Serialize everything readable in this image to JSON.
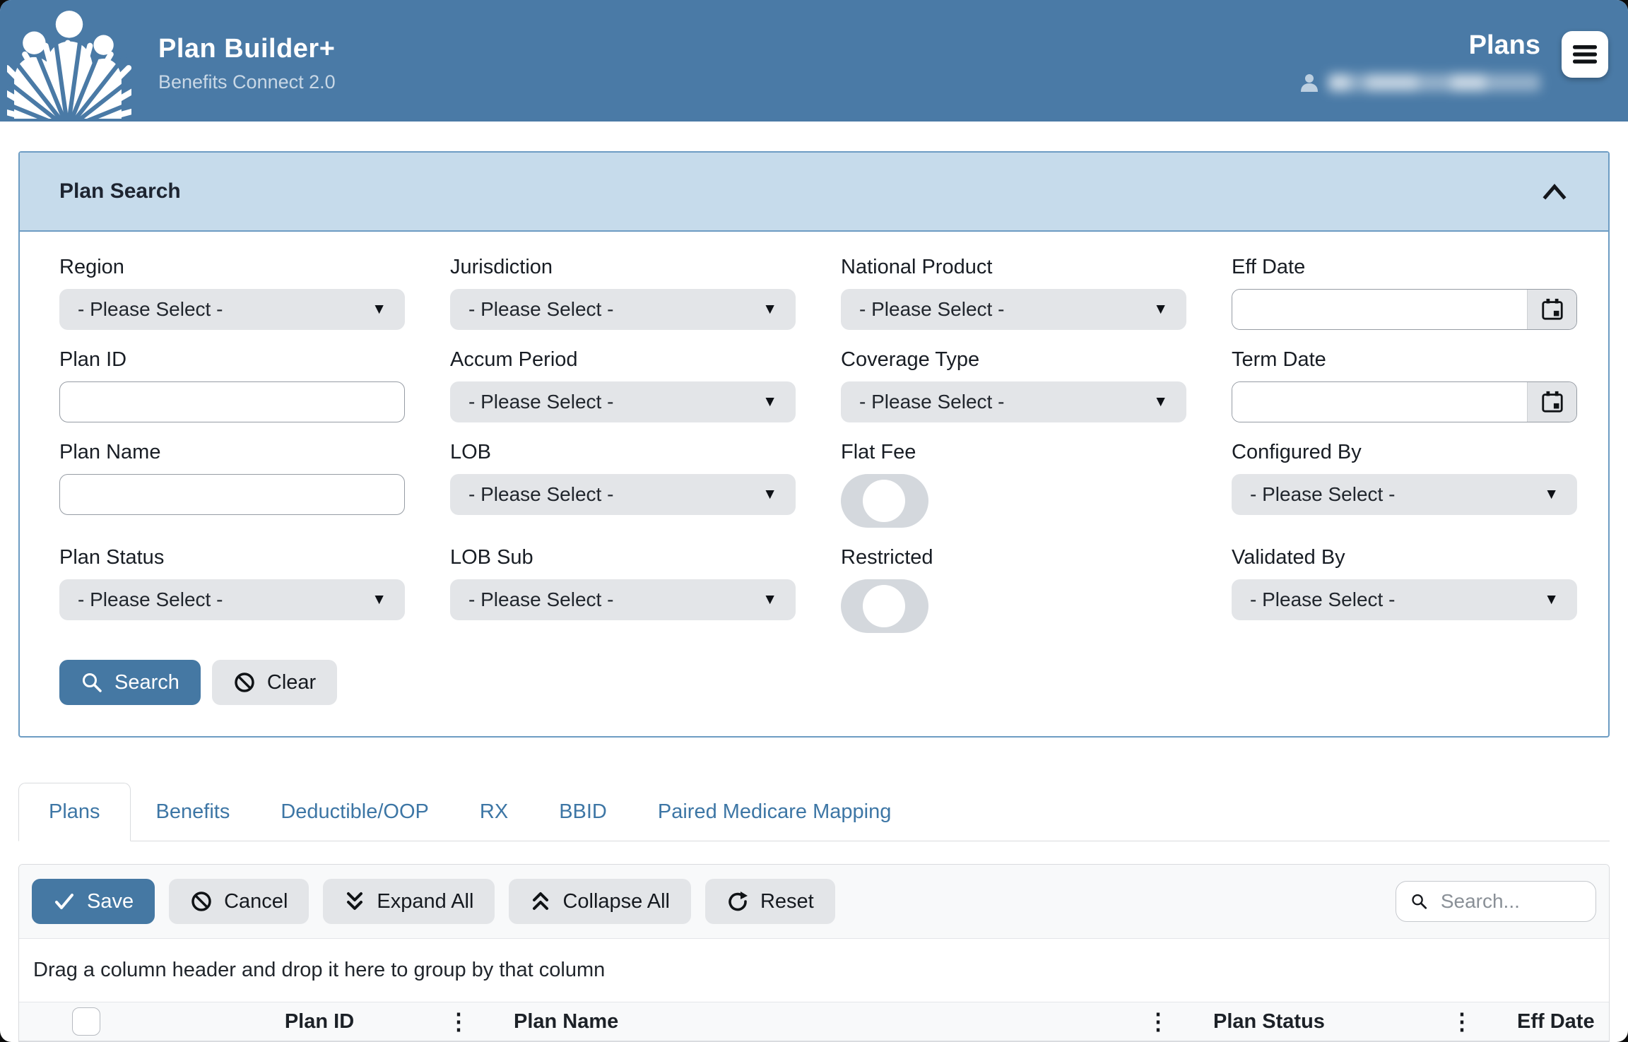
{
  "header": {
    "app_title": "Plan Builder+",
    "app_subtitle": "Benefits Connect 2.0",
    "page_title": "Plans",
    "user_email_redacted": true
  },
  "icons": {
    "caret_down": "▼",
    "column_menu": "⋮"
  },
  "plan_search": {
    "title": "Plan Search",
    "fields": {
      "region": {
        "label": "Region",
        "value": "- Please Select -"
      },
      "jurisdiction": {
        "label": "Jurisdiction",
        "value": "- Please Select -"
      },
      "national_product": {
        "label": "National Product",
        "value": "- Please Select -"
      },
      "eff_date": {
        "label": "Eff Date",
        "value": ""
      },
      "plan_id": {
        "label": "Plan ID",
        "value": ""
      },
      "accum_period": {
        "label": "Accum Period",
        "value": "- Please Select -"
      },
      "coverage_type": {
        "label": "Coverage Type",
        "value": "- Please Select -"
      },
      "term_date": {
        "label": "Term Date",
        "value": ""
      },
      "plan_name": {
        "label": "Plan Name",
        "value": ""
      },
      "lob": {
        "label": "LOB",
        "value": "- Please Select -"
      },
      "flat_fee": {
        "label": "Flat Fee",
        "state": "off"
      },
      "configured_by": {
        "label": "Configured By",
        "value": "- Please Select -"
      },
      "plan_status": {
        "label": "Plan Status",
        "value": "- Please Select -"
      },
      "lob_sub": {
        "label": "LOB Sub",
        "value": "- Please Select -"
      },
      "restricted": {
        "label": "Restricted",
        "state": "off"
      },
      "validated_by": {
        "label": "Validated By",
        "value": "- Please Select -"
      }
    },
    "buttons": {
      "search": "Search",
      "clear": "Clear"
    }
  },
  "tabs": [
    {
      "label": "Plans",
      "active": true
    },
    {
      "label": "Benefits",
      "active": false
    },
    {
      "label": "Deductible/OOP",
      "active": false
    },
    {
      "label": "RX",
      "active": false
    },
    {
      "label": "BBID",
      "active": false
    },
    {
      "label": "Paired Medicare Mapping",
      "active": false
    }
  ],
  "toolbar": {
    "save": "Save",
    "cancel": "Cancel",
    "expand_all": "Expand All",
    "collapse_all": "Collapse All",
    "reset": "Reset",
    "search_placeholder": "Search..."
  },
  "grid": {
    "group_hint": "Drag a column header and drop it here to group by that column",
    "columns": [
      {
        "title": "Plan ID"
      },
      {
        "title": "Plan Name"
      },
      {
        "title": "Plan Status"
      },
      {
        "title": "Eff Date"
      }
    ],
    "rows": []
  },
  "colors": {
    "header_blue": "#4a7aa6",
    "panel_header_blue": "#c6dbeb",
    "panel_border_blue": "#6d9cc3",
    "accent_button_blue": "#4578a3",
    "control_gray": "#e3e5e8",
    "tab_text_blue": "#3d76a5"
  }
}
